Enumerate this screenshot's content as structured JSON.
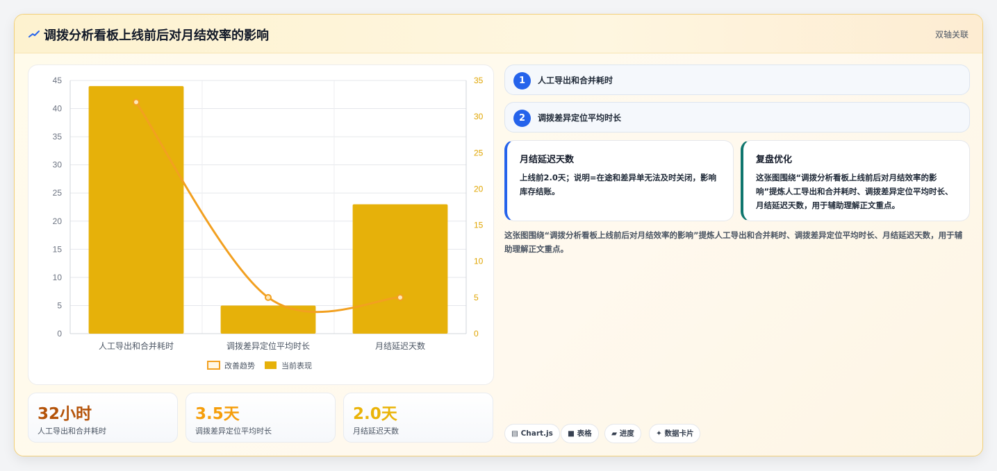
{
  "header": {
    "title": "调拨分析看板上线前后对月结效率的影响",
    "badge": "双轴关联"
  },
  "colors": {
    "bar": "#e6b10a",
    "line": "#f2a020",
    "right_axis": "#e0a500",
    "step_badge": "#2563eb",
    "note1_accent": "#2563eb",
    "note2_accent": "#0f766e"
  },
  "chart_data": {
    "type": "bar",
    "categories": [
      "人工导出和合并耗时",
      "调拨差异定位平均时长",
      "月结延迟天数"
    ],
    "series": [
      {
        "name": "当前表现",
        "type": "bar",
        "axis": "left",
        "values": [
          44,
          5,
          23
        ]
      },
      {
        "name": "改善趋势",
        "type": "line",
        "axis": "right",
        "values": [
          32,
          5,
          5
        ]
      }
    ],
    "y_left": {
      "min": 0,
      "max": 45,
      "step": 5,
      "ticks": [
        "0",
        "5",
        "10",
        "15",
        "20",
        "25",
        "30",
        "35",
        "40",
        "45"
      ]
    },
    "y_right": {
      "min": 0,
      "max": 35,
      "step": 5,
      "ticks": [
        "0",
        "5",
        "10",
        "15",
        "20",
        "25",
        "30",
        "35"
      ]
    },
    "legend": [
      "改善趋势",
      "当前表现"
    ],
    "legend_position": "bottom",
    "grid": true
  },
  "kpis": [
    {
      "value": "32小时",
      "label": "人工导出和合并耗时",
      "color": "#b45309"
    },
    {
      "value": "3.5天",
      "label": "调拨差异定位平均时长",
      "color": "#f59e0b"
    },
    {
      "value": "2.0天",
      "label": "月结延迟天数",
      "color": "#eab308"
    }
  ],
  "steps": [
    {
      "num": "1",
      "label": "人工导出和合并耗时"
    },
    {
      "num": "2",
      "label": "调拨差异定位平均时长"
    }
  ],
  "notes": [
    {
      "title": "月结延迟天数",
      "body": "上线前2.0天；说明=在途和差异单无法及时关闭，影响库存结账。"
    },
    {
      "title": "复盘优化",
      "body": "这张图围绕“调拨分析看板上线前后对月结效率的影响”提炼人工导出和合并耗时、调拨差异定位平均时长、月结延迟天数，用于辅助理解正文重点。"
    }
  ],
  "summary": "这张图围绕“调拨分析看板上线前后对月结效率的影响”提炼人工导出和合并耗时、调拨差异定位平均时长、月结延迟天数，用于辅助理解正文重点。",
  "tags": [
    {
      "icon": "▤",
      "label": "Chart.js"
    },
    {
      "icon": "■",
      "label": "表格"
    },
    {
      "icon": "▰",
      "label": "进度"
    },
    {
      "icon": "✦",
      "label": "数据卡片"
    }
  ]
}
